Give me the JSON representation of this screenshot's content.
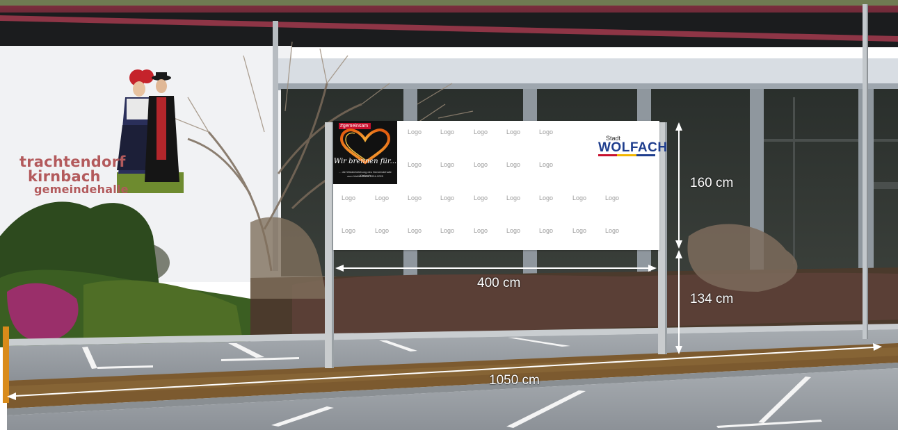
{
  "wall_sign": {
    "line1": "trachtendorf",
    "line2": "kirnbach",
    "line3": "gemeindehalle"
  },
  "billboard": {
    "logo_label": "Logo",
    "logo_count": 31,
    "partner": {
      "tag": "#gemeinsam",
      "script_text": "Wir brennen für...",
      "fine_line1": "... die Wiederbelebung des Gemeindehalle Kirnbach",
      "fine_line2": "zum Vielfachhaus 2024-2025",
      "heart_color": "#f08a1c"
    },
    "city_logo": {
      "small": "Stadt",
      "big": "WOLFACH",
      "color": "#1f3e8e",
      "stripe_colors": [
        "#c8102e",
        "#f2b600",
        "#1f3e8e"
      ]
    }
  },
  "dimensions": {
    "width": "400 cm",
    "height": "160 cm",
    "post_height": "134 cm",
    "total_length": "1050 cm"
  },
  "colors": {
    "roof": "#6a2b3a",
    "wall": "#f1f2f4",
    "wall_text": "#b35a5c",
    "asphalt": "#9aa0a6",
    "arrow": "#ffffff"
  }
}
